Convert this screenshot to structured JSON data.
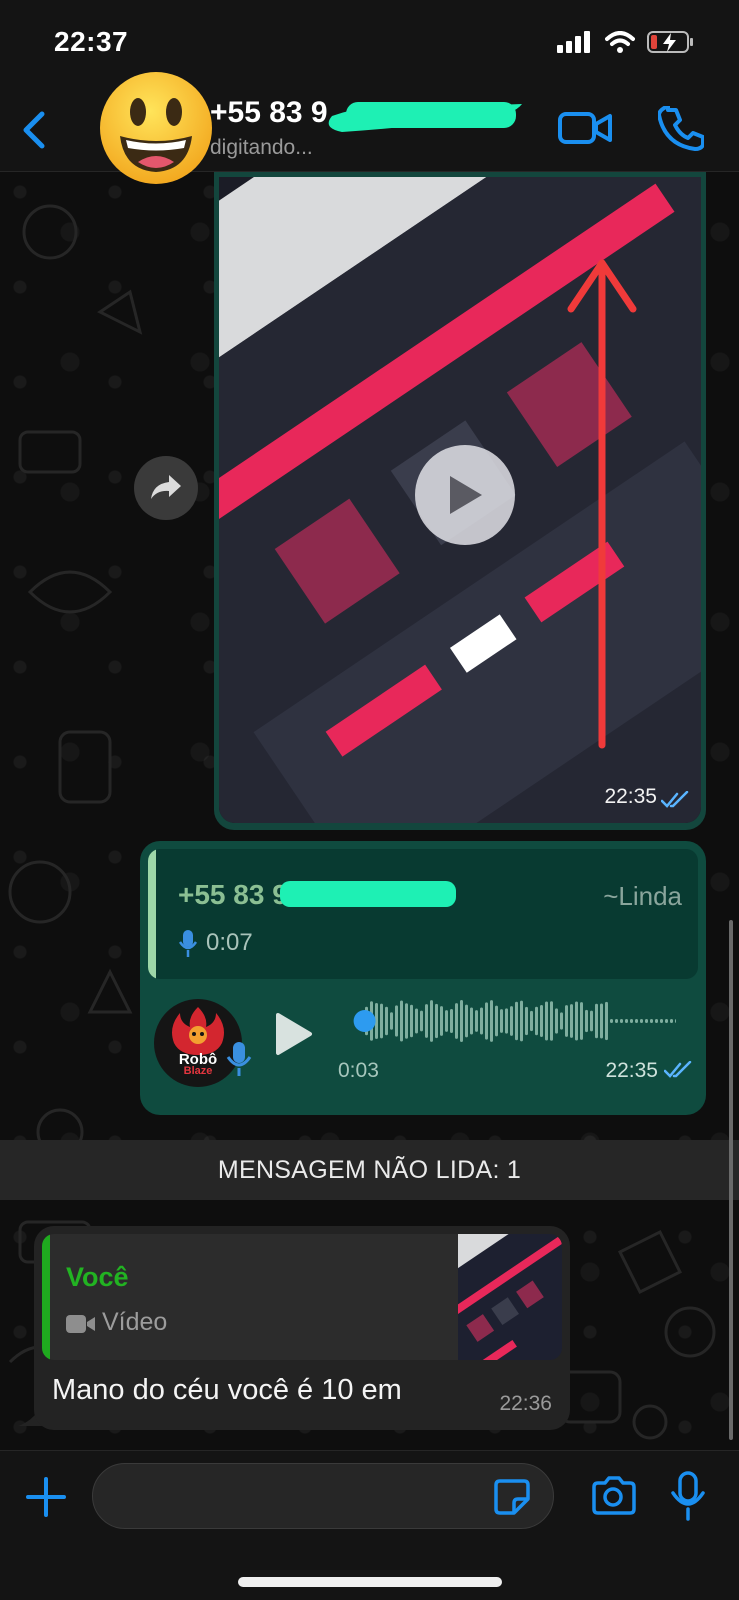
{
  "status_bar": {
    "time": "22:37",
    "icons": [
      "signal-icon",
      "wifi-icon",
      "battery-charging-icon"
    ],
    "battery_color": "#e0443a"
  },
  "header": {
    "contact_name": "+55 83 9",
    "contact_status": "digitando...",
    "avatar_icon": "smiley-emoji",
    "accent": "#1a8ff0",
    "redaction_color": "#1ef0b4"
  },
  "video_message": {
    "time": "22:35",
    "status": "read",
    "icon": "play-icon",
    "bubble_color": "#13463d",
    "arrow_color": "#f03a3a"
  },
  "audio_message": {
    "quoted": {
      "sender": "+55 83 9",
      "alias": "~Linda",
      "duration": "0:07"
    },
    "avatar_text": [
      "Robô",
      "Blaze"
    ],
    "elapsed": "0:03",
    "time": "22:35",
    "status": "read",
    "played_fraction": 0.05,
    "bubble_color": "#0f4b3f"
  },
  "unread_banner": {
    "text": "MENSAGEM NÃO LIDA: 1"
  },
  "reply_message": {
    "quoted": {
      "sender": "Você",
      "media_label": "Vídeo"
    },
    "text": "Mano do céu você é 10 em",
    "time": "22:36",
    "sender_color": "#22b322"
  },
  "composer": {
    "placeholder": "",
    "icons": [
      "plus-icon",
      "sticker-icon",
      "camera-icon",
      "microphone-icon"
    ]
  }
}
